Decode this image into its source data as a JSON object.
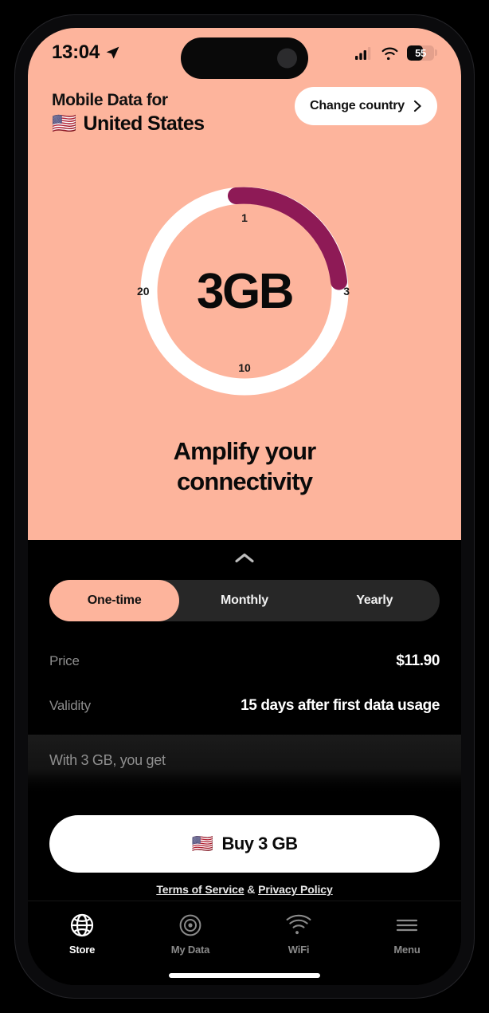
{
  "status_bar": {
    "time": "13:04",
    "location_icon": "location-arrow-icon",
    "cellular_icon": "cellular-bars-icon",
    "wifi_icon": "wifi-icon",
    "battery_percent": "55",
    "battery_level": 55
  },
  "header": {
    "kicker": "Mobile Data for",
    "flag": "🇺🇸",
    "country": "United States",
    "change_country_label": "Change country",
    "change_country_chevron": "chevron-right-icon"
  },
  "gauge": {
    "value": "3GB",
    "ticks": [
      "1",
      "3",
      "10",
      "20"
    ],
    "arc_color": "#8E1A56",
    "track_color": "#FFFFFF",
    "background_color": "#FDB49C",
    "arc_start_deg": -5,
    "arc_end_deg": 92
  },
  "tagline": {
    "line1": "Amplify your",
    "line2": "connectivity"
  },
  "sheet": {
    "collapse_icon": "chevron-up-icon",
    "tabs": [
      {
        "label": "One-time",
        "active": true
      },
      {
        "label": "Monthly",
        "active": false
      },
      {
        "label": "Yearly",
        "active": false
      }
    ],
    "details": [
      {
        "label": "Price",
        "value": "$11.90"
      },
      {
        "label": "Validity",
        "value": "15 days after first data usage"
      }
    ],
    "included_title": "With 3 GB, you get"
  },
  "buy": {
    "flag": "🇺🇸",
    "label": "Buy 3 GB",
    "legal_terms": "Terms of Service",
    "legal_amp": " & ",
    "legal_privacy": "Privacy Policy"
  },
  "bottom_nav": [
    {
      "label": "Store",
      "icon": "globe-icon",
      "active": true
    },
    {
      "label": "My Data",
      "icon": "radar-icon",
      "active": false
    },
    {
      "label": "WiFi",
      "icon": "wifi-icon",
      "active": false
    },
    {
      "label": "Menu",
      "icon": "hamburger-menu-icon",
      "active": false
    }
  ],
  "colors": {
    "accent_peach": "#FDB49C",
    "accent_purple": "#8E1A56",
    "sheet_background": "#000000",
    "tab_track": "#272727"
  }
}
